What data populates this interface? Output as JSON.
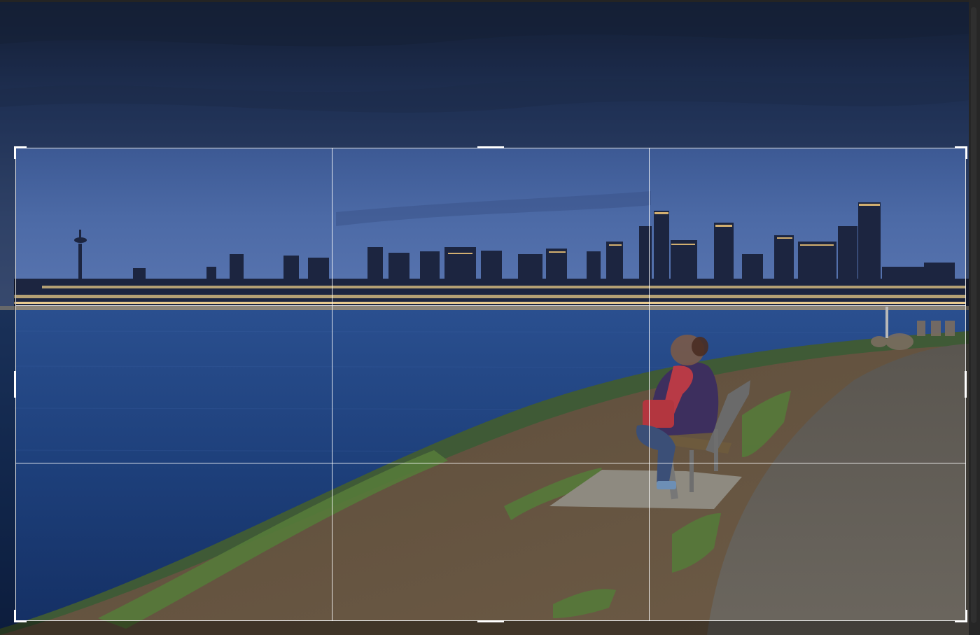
{
  "app": {
    "mode": "crop"
  },
  "photo": {
    "subject": "city-skyline-at-dusk-with-person-on-bench",
    "colors": {
      "sky": "#3e5a93",
      "water": "#1d3f7a",
      "ground": "#6b5a45",
      "path": "#6a655d"
    }
  },
  "crop_overlay": {
    "guide": "rule-of-thirds",
    "border_color": "#e6e6e6",
    "handle_color": "#ffffff",
    "shade_color": "rgba(0,0,0,0.38)"
  }
}
